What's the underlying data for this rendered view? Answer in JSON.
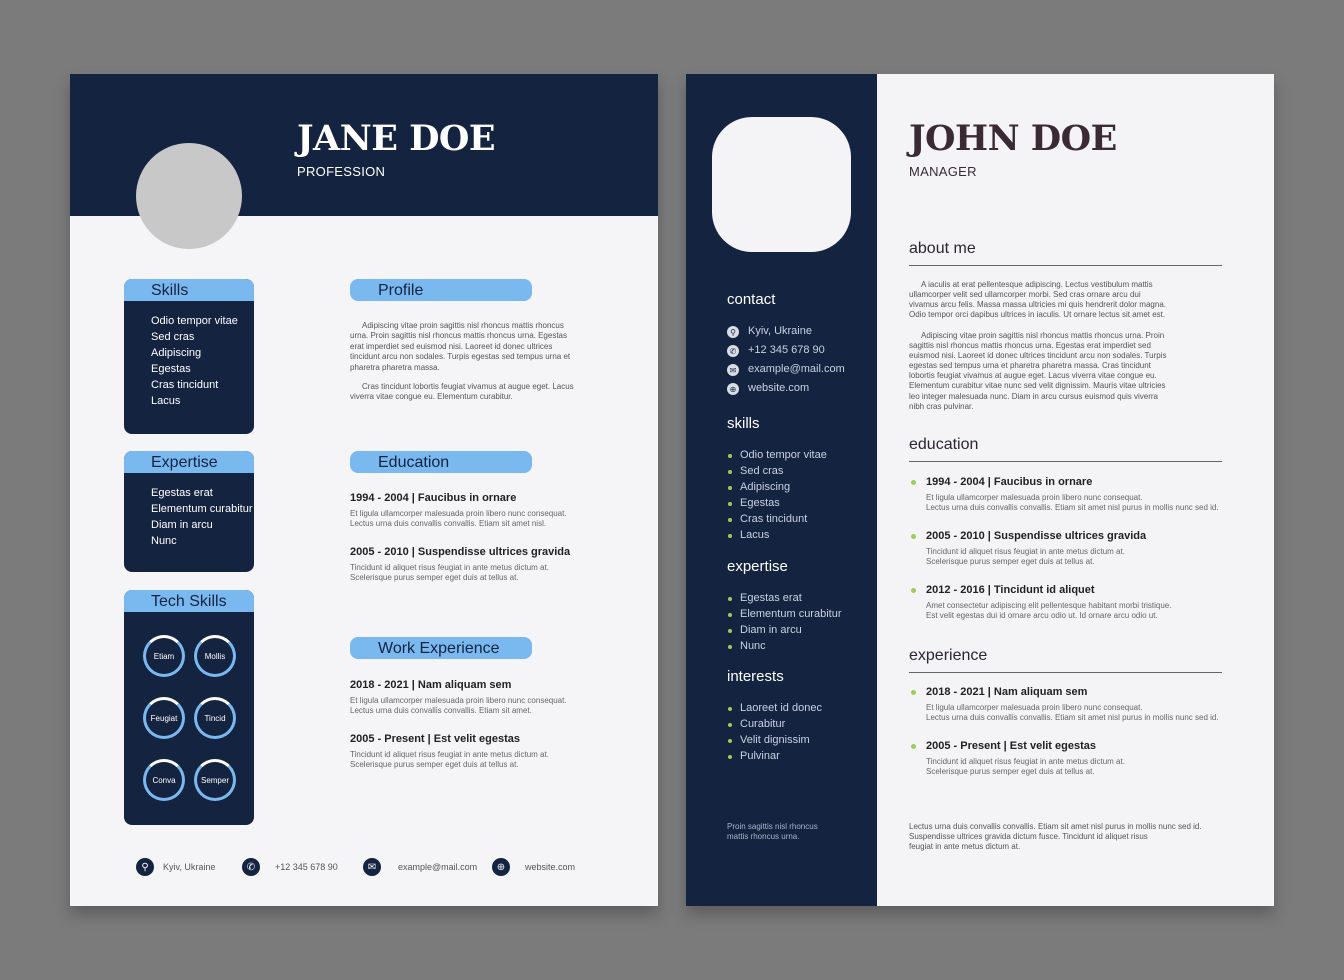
{
  "colors": {
    "navy": "#14233f",
    "accent_blue": "#7ab8f0",
    "bullet_green": "#9acd5a",
    "background": "#7b7b7b"
  },
  "left": {
    "name": "JANE DOE",
    "profession": "PROFESSION",
    "skills": {
      "title": "Skills",
      "items": [
        "Odio tempor vitae",
        "Sed cras",
        "Adipiscing",
        "Egestas",
        "Cras tincidunt",
        "Lacus"
      ]
    },
    "expertise": {
      "title": "Expertise",
      "items": [
        "Egestas erat",
        "Elementum curabitur",
        "Diam in arcu",
        "Nunc"
      ]
    },
    "tech": {
      "title": "Tech Skills",
      "items": [
        "Etiam",
        "Mollis",
        "Feugiat",
        "Tincid",
        "Conva",
        "Semper"
      ]
    },
    "profile": {
      "title": "Profile",
      "paragraphs": [
        "Adipiscing vitae proin sagittis nisl rhoncus mattis rhoncus urna. Proin sagittis nisl rhoncus mattis rhoncus urna. Egestas erat imperdiet sed euismod nisi. Laoreet id donec ultrices tincidunt arcu non sodales. Turpis egestas sed tempus urna et pharetra pharetra massa.",
        "Cras tincidunt lobortis feugiat vivamus at augue eget. Lacus viverra vitae congue eu. Elementum curabitur."
      ]
    },
    "education": {
      "title": "Education",
      "entries": [
        {
          "title": "1994 - 2004 | Faucibus in ornare",
          "lines": [
            "Et ligula ullamcorper malesuada proin libero nunc consequat.",
            "Lectus urna duis convallis convallis. Etiam sit amet nisl."
          ]
        },
        {
          "title": "2005 - 2010 | Suspendisse ultrices gravida",
          "lines": [
            "Tincidunt id aliquet risus feugiat in ante metus dictum at.",
            "Scelerisque purus semper eget duis at tellus at."
          ]
        }
      ]
    },
    "work": {
      "title": "Work Experience",
      "entries": [
        {
          "title": "2018 - 2021 | Nam aliquam sem",
          "lines": [
            "Et ligula ullamcorper malesuada proin libero nunc consequat.",
            "Lectus urna duis convallis convallis. Etiam sit amet."
          ]
        },
        {
          "title": "2005 - Present | Est velit egestas",
          "lines": [
            "Tincidunt id aliquet risus feugiat in ante metus dictum at.",
            "Scelerisque purus semper eget duis at tellus at."
          ]
        }
      ]
    },
    "contacts": [
      {
        "icon": "location-icon",
        "text": "Kyiv, Ukraine"
      },
      {
        "icon": "phone-icon",
        "text": "+12 345 678 90"
      },
      {
        "icon": "mail-icon",
        "text": "example@mail.com"
      },
      {
        "icon": "globe-icon",
        "text": "website.com"
      }
    ]
  },
  "right": {
    "name": "JOHN DOE",
    "profession": "MANAGER",
    "contact": {
      "title": "contact",
      "items": [
        {
          "icon": "location-icon",
          "text": "Kyiv, Ukraine"
        },
        {
          "icon": "phone-icon",
          "text": "+12 345 678 90"
        },
        {
          "icon": "mail-icon",
          "text": "example@mail.com"
        },
        {
          "icon": "globe-icon",
          "text": "website.com"
        }
      ]
    },
    "skills": {
      "title": "skills",
      "items": [
        "Odio tempor vitae",
        "Sed cras",
        "Adipiscing",
        "Egestas",
        "Cras tincidunt",
        "Lacus"
      ]
    },
    "expertise": {
      "title": "expertise",
      "items": [
        "Egestas erat",
        "Elementum curabitur",
        "Diam in arcu",
        "Nunc"
      ]
    },
    "interests": {
      "title": "interests",
      "items": [
        "Laoreet id donec",
        "Curabitur",
        "Velit dignissim",
        "Pulvinar"
      ]
    },
    "sidebar_note": "Proin sagittis nisl rhoncus mattis rhoncus urna.",
    "about": {
      "title": "about me",
      "paragraphs": [
        "A iaculis at erat pellentesque adipiscing. Lectus vestibulum mattis ullamcorper velit sed ullamcorper morbi. Sed cras ornare arcu dui vivamus arcu felis. Massa massa ultricies mi quis hendrerit dolor magna. Odio tempor orci dapibus ultrices in iaculis. Ut ornare lectus sit amet est.",
        "Adipiscing vitae proin sagittis nisl rhoncus mattis rhoncus urna. Proin sagittis nisl rhoncus mattis rhoncus urna. Egestas erat imperdiet sed euismod nisi. Laoreet id donec ultrices tincidunt arcu non sodales. Turpis egestas sed tempus urna et pharetra pharetra massa. Cras tincidunt lobortis feugiat vivamus at augue eget. Lacus viverra vitae congue eu. Elementum curabitur vitae nunc sed velit dignissim. Mauris vitae ultricies leo integer malesuada nunc. Diam in arcu cursus euismod quis viverra nibh cras pulvinar."
      ]
    },
    "education": {
      "title": "education",
      "entries": [
        {
          "title": "1994 - 2004 | Faucibus in ornare",
          "lines": [
            "Et ligula ullamcorper malesuada proin libero nunc consequat.",
            "Lectus urna duis convallis convallis. Etiam sit amet nisl purus in mollis nunc sed id."
          ]
        },
        {
          "title": "2005 - 2010 | Suspendisse ultrices gravida",
          "lines": [
            "Tincidunt id aliquet risus feugiat in ante metus dictum at.",
            "Scelerisque purus semper eget duis at tellus at."
          ]
        },
        {
          "title": "2012 - 2016 | Tincidunt id aliquet",
          "lines": [
            "Amet consectetur adipiscing elit pellentesque habitant morbi tristique.",
            "Est velit egestas dui id ornare arcu odio ut. Id ornare arcu odio ut."
          ]
        }
      ]
    },
    "experience": {
      "title": "experience",
      "entries": [
        {
          "title": "2018 - 2021 | Nam aliquam sem",
          "lines": [
            "Et ligula ullamcorper malesuada proin libero nunc consequat.",
            "Lectus urna duis convallis convallis. Etiam sit amet nisl purus in mollis nunc sed id."
          ]
        },
        {
          "title": "2005 - Present | Est velit egestas",
          "lines": [
            "Tincidunt id aliquet risus feugiat in ante metus dictum at.",
            "Scelerisque purus semper eget duis at tellus at."
          ]
        }
      ]
    },
    "footer_lines": [
      "Lectus urna duis convallis convallis. Etiam sit amet nisl purus in mollis nunc sed id.",
      "Suspendisse ultrices gravida dictum fusce. Tincidunt id aliquet risus",
      "feugiat in ante metus dictum at."
    ]
  }
}
